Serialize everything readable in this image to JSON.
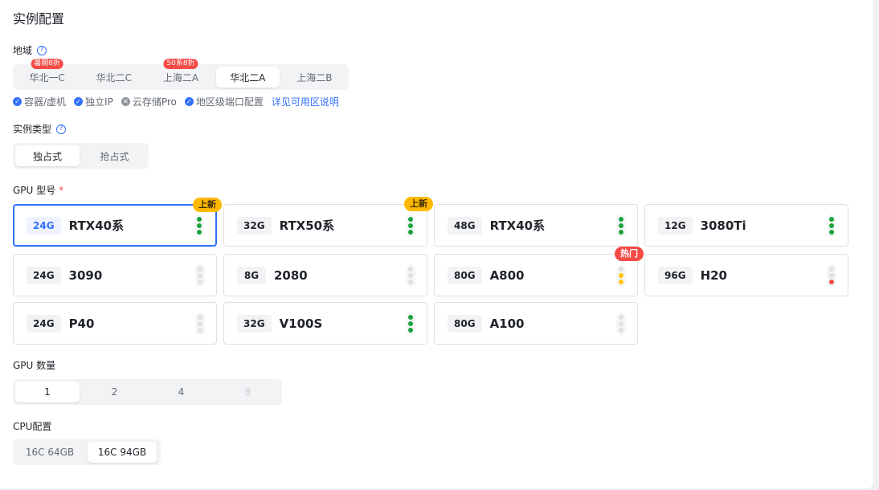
{
  "title": "实例配置",
  "region": {
    "label": "地域",
    "options": [
      {
        "label": "华北一C",
        "tag": "暑期8折"
      },
      {
        "label": "华北二C",
        "tag": ""
      },
      {
        "label": "上海二A",
        "tag": "50系8折"
      },
      {
        "label": "华北二A",
        "tag": ""
      },
      {
        "label": "上海二B",
        "tag": ""
      }
    ],
    "selected": "华北二A",
    "features": [
      {
        "label": "容器/虚机",
        "status": "check"
      },
      {
        "label": "独立IP",
        "status": "check"
      },
      {
        "label": "云存储Pro",
        "status": "cross"
      },
      {
        "label": "地区级端口配置",
        "status": "check"
      }
    ],
    "link": "详见可用区说明"
  },
  "instance_type": {
    "label": "实例类型",
    "options": [
      "独占式",
      "抢占式"
    ],
    "selected": "独占式"
  },
  "gpu_model": {
    "label": "GPU 型号",
    "required_mark": "*",
    "cards": [
      {
        "mem": "24G",
        "name": "RTX40系",
        "badge": "上新",
        "badge_type": "new",
        "lights": [
          "g",
          "g",
          "g"
        ],
        "selected": true
      },
      {
        "mem": "32G",
        "name": "RTX50系",
        "badge": "上新",
        "badge_type": "new",
        "lights": [
          "g",
          "g",
          "g"
        ]
      },
      {
        "mem": "48G",
        "name": "RTX40系",
        "badge": "",
        "lights": [
          "g",
          "g",
          "g"
        ]
      },
      {
        "mem": "12G",
        "name": "3080Ti",
        "badge": "",
        "lights": [
          "g",
          "g",
          "g"
        ]
      },
      {
        "mem": "24G",
        "name": "3090",
        "badge": "",
        "lights": [
          "n",
          "n",
          "n"
        ]
      },
      {
        "mem": "8G",
        "name": "2080",
        "badge": "",
        "lights": [
          "n",
          "n",
          "n"
        ]
      },
      {
        "mem": "80G",
        "name": "A800",
        "badge": "热门",
        "badge_type": "hot",
        "lights": [
          "n",
          "y",
          "y"
        ]
      },
      {
        "mem": "96G",
        "name": "H20",
        "badge": "",
        "lights": [
          "n",
          "n",
          "r"
        ]
      },
      {
        "mem": "24G",
        "name": "P40",
        "badge": "",
        "lights": [
          "n",
          "n",
          "n"
        ]
      },
      {
        "mem": "32G",
        "name": "V100S",
        "badge": "",
        "lights": [
          "g",
          "g",
          "g"
        ]
      },
      {
        "mem": "80G",
        "name": "A100",
        "badge": "",
        "lights": [
          "n",
          "n",
          "n"
        ]
      }
    ]
  },
  "gpu_count": {
    "label": "GPU 数量",
    "options": [
      "1",
      "2",
      "4",
      "8"
    ],
    "selected": "1",
    "disabled": [
      "8"
    ]
  },
  "cpu_config": {
    "label": "CPU配置",
    "options": [
      "16C 64GB",
      "16C 94GB"
    ],
    "selected": "16C 94GB"
  },
  "colors": {
    "accent": "#3370ff",
    "available": "#19a33b",
    "limited": "#ffc60a",
    "soldout": "#f54a45",
    "new_badge": "#ffb800",
    "hot_badge": "#f54a45"
  }
}
